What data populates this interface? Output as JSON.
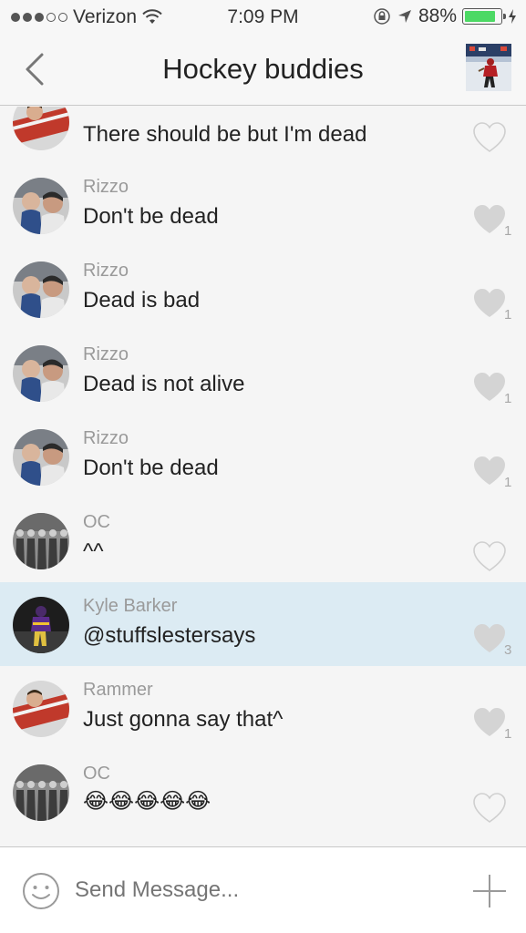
{
  "status_bar": {
    "carrier": "Verizon",
    "signal_bars_filled": 3,
    "signal_bars_total": 5,
    "time": "7:09 PM",
    "battery": "88%",
    "battery_level": 0.88,
    "battery_color": "#4cd964"
  },
  "header": {
    "title": "Hockey buddies",
    "back_icon": "chevron-left-icon"
  },
  "messages": [
    {
      "sender": "",
      "text": "There should be but I'm dead",
      "liked": false,
      "likes": ""
    },
    {
      "sender": "Rizzo",
      "text": "Don't be dead",
      "liked": true,
      "likes": "1"
    },
    {
      "sender": "Rizzo",
      "text": "Dead is bad",
      "liked": true,
      "likes": "1"
    },
    {
      "sender": "Rizzo",
      "text": "Dead is not alive",
      "liked": true,
      "likes": "1"
    },
    {
      "sender": "Rizzo",
      "text": "Don't be dead",
      "liked": true,
      "likes": "1"
    },
    {
      "sender": "OC",
      "text": "^^",
      "liked": false,
      "likes": ""
    },
    {
      "sender": "Kyle Barker",
      "text": "@stuffslestersays",
      "liked": true,
      "likes": "3",
      "highlighted": true
    },
    {
      "sender": "Rammer",
      "text": "Just gonna say that^",
      "liked": true,
      "likes": "1"
    },
    {
      "sender": "OC",
      "text": "😂😂😂😂😂",
      "liked": false,
      "likes": ""
    }
  ],
  "composer": {
    "placeholder": "Send Message...",
    "emoji_icon": "smiley-icon",
    "add_icon": "plus-icon"
  },
  "colors": {
    "highlight_row": "#dcebf3",
    "heart_filled": "#d4d4d4",
    "heart_outline": "#cfcfcf"
  }
}
